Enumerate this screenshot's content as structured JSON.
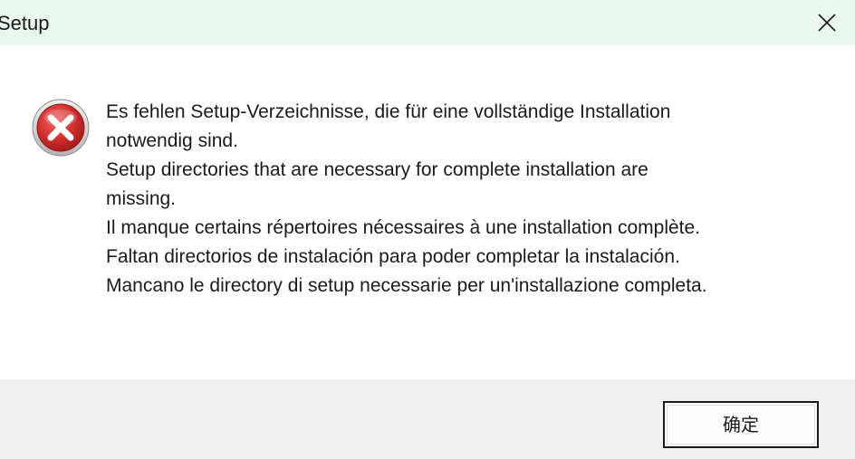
{
  "window": {
    "title": "Setup"
  },
  "titlebar": {
    "close_icon": "close-icon"
  },
  "dialog": {
    "icon": "error-icon",
    "messages": [
      "Es fehlen Setup-Verzeichnisse, die für eine vollständige Installation",
      "notwendig sind.",
      "Setup directories that are necessary for complete installation are",
      "missing.",
      "Il manque certains répertoires nécessaires à une installation complète.",
      "Faltan directorios de instalación para poder completar la instalación.",
      "Mancano le directory di setup necessarie per un'installazione completa."
    ]
  },
  "footer": {
    "ok_label": "确定"
  },
  "colors": {
    "titlebar_bg": "#eaf7ef",
    "footer_bg": "#f0f0f0",
    "error_red": "#c62828"
  }
}
